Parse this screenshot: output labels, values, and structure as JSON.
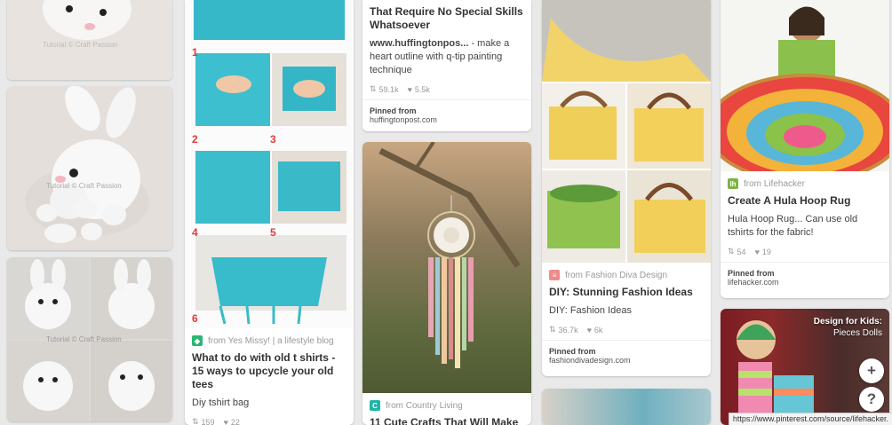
{
  "pins": {
    "bunny": {
      "watermark": "Tutorial © Craft Passion"
    },
    "tshirt": {
      "step_numbers": [
        "1",
        "2",
        "3",
        "4",
        "5",
        "6"
      ],
      "source": "from Yes Missy! | a lifestyle blog",
      "title": "What to do with old t shirts - 15 ways to upcycle your old tees",
      "desc": "Diy tshirt bag",
      "repins": "159",
      "likes": "22"
    },
    "huffpost": {
      "title": "That Require No Special Skills Whatsoever",
      "desc_bold": "www.huffingtonpos...",
      "desc": " - make a heart outline with q-tip painting technique",
      "repins": "59.1k",
      "likes": "5.5k",
      "pinned_from_label": "Pinned from",
      "pinned_from_site": "huffingtonpost.com"
    },
    "dreamcatcher": {
      "source": "from Country Living",
      "title": "11 Cute Crafts That Will Make"
    },
    "fashion": {
      "source": "from Fashion Diva Design",
      "title": "DIY: Stunning Fashion Ideas",
      "desc": "DIY: Fashion Ideas",
      "repins": "36.7k",
      "likes": "6k",
      "pinned_from_label": "Pinned from",
      "pinned_from_site": "fashiondivadesign.com"
    },
    "hulahoop": {
      "source": "from Lifehacker",
      "title": "Create A Hula Hoop Rug",
      "desc": "Hula Hoop Rug... Can use old tshirts for the fabric!",
      "repins": "54",
      "likes": "19",
      "pinned_from_label": "Pinned from",
      "pinned_from_site": "lifehacker.com"
    },
    "dolls": {
      "overlay_title": "Design for Kids:",
      "overlay_sub": "Pieces Dolls"
    }
  },
  "icons": {
    "repin": "repin-icon",
    "like": "heart-icon",
    "add": "plus-icon",
    "help": "help-icon"
  },
  "floating": {
    "add_label": "+",
    "help_label": "?"
  },
  "status_url": "https://www.pinterest.com/source/lifehacker."
}
